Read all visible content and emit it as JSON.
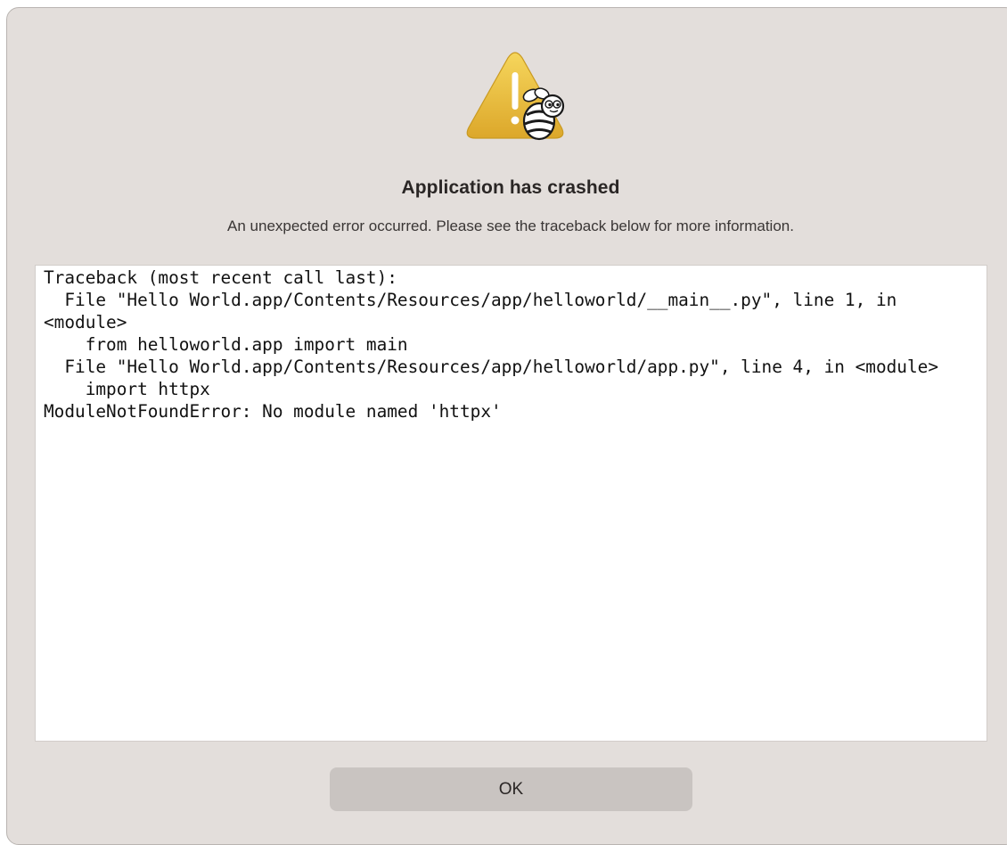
{
  "dialog": {
    "icon": "warning-triangle-with-bee-icon",
    "title": "Application has crashed",
    "message": "An unexpected error occurred. Please see the traceback below for more information.",
    "traceback": "Traceback (most recent call last):\n  File \"Hello World.app/Contents/Resources/app/helloworld/__main__.py\", line 1, in <module>\n    from helloworld.app import main\n  File \"Hello World.app/Contents/Resources/app/helloworld/app.py\", line 4, in <module>\n    import httpx\nModuleNotFoundError: No module named 'httpx'",
    "ok_label": "OK"
  },
  "colors": {
    "dialog_background": "#e3dedb",
    "button_background": "#c9c4c1",
    "warning_yellow": "#f0c53d"
  }
}
